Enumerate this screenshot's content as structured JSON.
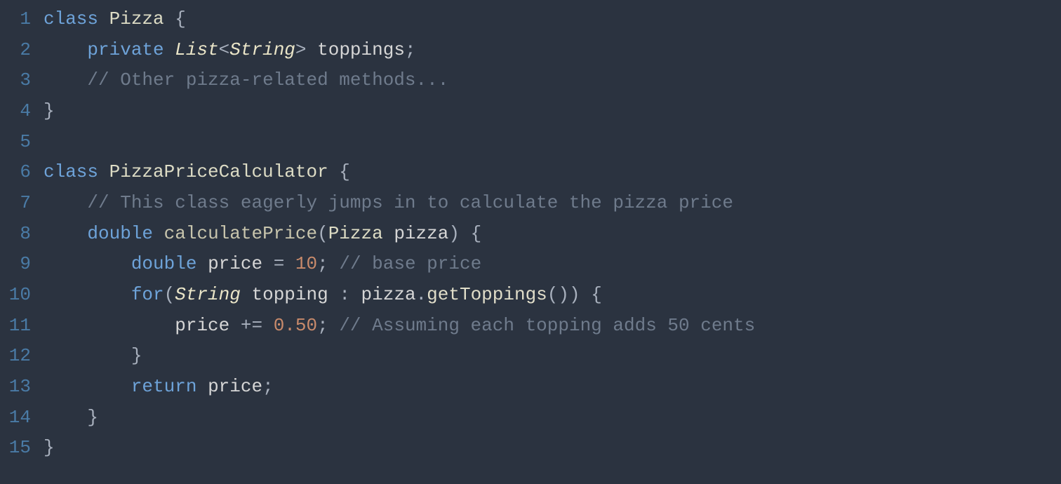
{
  "lines": [
    {
      "num": "1",
      "tokens": [
        {
          "cls": "keyword",
          "t": "class"
        },
        {
          "cls": "",
          "t": " "
        },
        {
          "cls": "classname",
          "t": "Pizza"
        },
        {
          "cls": "",
          "t": " "
        },
        {
          "cls": "punct",
          "t": "{"
        }
      ]
    },
    {
      "num": "2",
      "indent": "    ",
      "tokens": [
        {
          "cls": "keyword",
          "t": "private"
        },
        {
          "cls": "",
          "t": " "
        },
        {
          "cls": "type",
          "t": "List"
        },
        {
          "cls": "punct",
          "t": "<"
        },
        {
          "cls": "type",
          "t": "String"
        },
        {
          "cls": "punct",
          "t": ">"
        },
        {
          "cls": "",
          "t": " "
        },
        {
          "cls": "identifier",
          "t": "toppings"
        },
        {
          "cls": "punct",
          "t": ";"
        }
      ]
    },
    {
      "num": "3",
      "indent": "    ",
      "tokens": [
        {
          "cls": "comment",
          "t": "// Other pizza-related methods..."
        }
      ]
    },
    {
      "num": "4",
      "tokens": [
        {
          "cls": "punct",
          "t": "}"
        }
      ]
    },
    {
      "num": "5",
      "tokens": []
    },
    {
      "num": "6",
      "tokens": [
        {
          "cls": "keyword",
          "t": "class"
        },
        {
          "cls": "",
          "t": " "
        },
        {
          "cls": "classname",
          "t": "PizzaPriceCalculator"
        },
        {
          "cls": "",
          "t": " "
        },
        {
          "cls": "punct",
          "t": "{"
        }
      ]
    },
    {
      "num": "7",
      "indent": "    ",
      "tokens": [
        {
          "cls": "comment",
          "t": "// This class eagerly jumps in to calculate the pizza price"
        }
      ]
    },
    {
      "num": "8",
      "indent": "    ",
      "tokens": [
        {
          "cls": "keyword",
          "t": "double"
        },
        {
          "cls": "",
          "t": " "
        },
        {
          "cls": "method",
          "t": "calculatePrice"
        },
        {
          "cls": "punct",
          "t": "("
        },
        {
          "cls": "classname",
          "t": "Pizza"
        },
        {
          "cls": "",
          "t": " "
        },
        {
          "cls": "identifier",
          "t": "pizza"
        },
        {
          "cls": "punct",
          "t": ")"
        },
        {
          "cls": "",
          "t": " "
        },
        {
          "cls": "punct",
          "t": "{"
        }
      ]
    },
    {
      "num": "9",
      "indent": "        ",
      "tokens": [
        {
          "cls": "keyword",
          "t": "double"
        },
        {
          "cls": "",
          "t": " "
        },
        {
          "cls": "identifier",
          "t": "price"
        },
        {
          "cls": "",
          "t": " "
        },
        {
          "cls": "operator",
          "t": "="
        },
        {
          "cls": "",
          "t": " "
        },
        {
          "cls": "number",
          "t": "10"
        },
        {
          "cls": "punct",
          "t": ";"
        },
        {
          "cls": "",
          "t": " "
        },
        {
          "cls": "comment",
          "t": "// base price"
        }
      ]
    },
    {
      "num": "10",
      "indent": "        ",
      "tokens": [
        {
          "cls": "keyword",
          "t": "for"
        },
        {
          "cls": "punct",
          "t": "("
        },
        {
          "cls": "type",
          "t": "String"
        },
        {
          "cls": "",
          "t": " "
        },
        {
          "cls": "identifier",
          "t": "topping"
        },
        {
          "cls": "",
          "t": " "
        },
        {
          "cls": "operator",
          "t": ":"
        },
        {
          "cls": "",
          "t": " "
        },
        {
          "cls": "identifier",
          "t": "pizza"
        },
        {
          "cls": "punct",
          "t": "."
        },
        {
          "cls": "methodcall",
          "t": "getToppings"
        },
        {
          "cls": "punct",
          "t": "()"
        },
        {
          "cls": "punct",
          "t": ")"
        },
        {
          "cls": "",
          "t": " "
        },
        {
          "cls": "punct",
          "t": "{"
        }
      ]
    },
    {
      "num": "11",
      "indent": "            ",
      "tokens": [
        {
          "cls": "identifier",
          "t": "price"
        },
        {
          "cls": "",
          "t": " "
        },
        {
          "cls": "operator",
          "t": "+="
        },
        {
          "cls": "",
          "t": " "
        },
        {
          "cls": "number",
          "t": "0.50"
        },
        {
          "cls": "punct",
          "t": ";"
        },
        {
          "cls": "",
          "t": " "
        },
        {
          "cls": "comment",
          "t": "// Assuming each topping adds 50 cents"
        }
      ]
    },
    {
      "num": "12",
      "indent": "        ",
      "tokens": [
        {
          "cls": "punct",
          "t": "}"
        }
      ]
    },
    {
      "num": "13",
      "indent": "        ",
      "tokens": [
        {
          "cls": "keyword",
          "t": "return"
        },
        {
          "cls": "",
          "t": " "
        },
        {
          "cls": "identifier",
          "t": "price"
        },
        {
          "cls": "punct",
          "t": ";"
        }
      ]
    },
    {
      "num": "14",
      "indent": "    ",
      "tokens": [
        {
          "cls": "punct",
          "t": "}"
        }
      ]
    },
    {
      "num": "15",
      "tokens": [
        {
          "cls": "punct",
          "t": "}"
        }
      ]
    }
  ]
}
